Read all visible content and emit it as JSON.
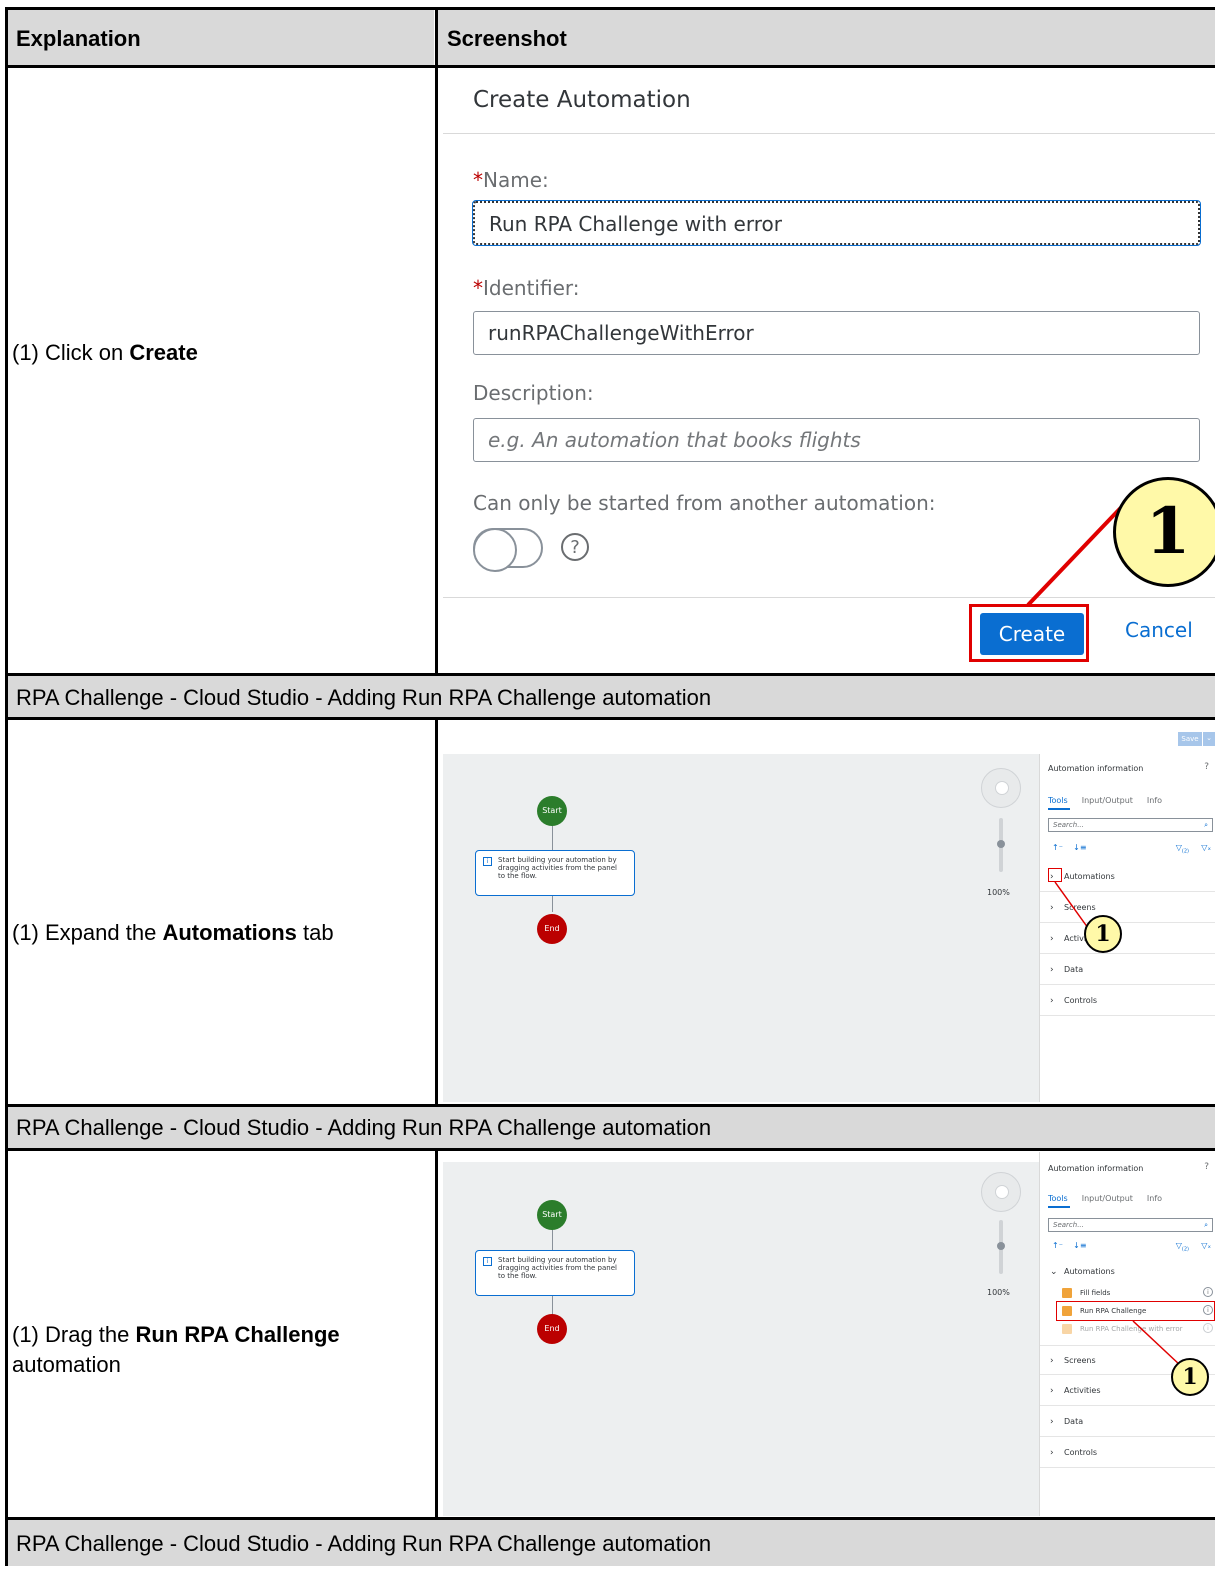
{
  "table": {
    "header_explanation": "Explanation",
    "header_screenshot": "Screenshot"
  },
  "rows": [
    {
      "step_prefix": "(1) Click on ",
      "step_bold": "Create",
      "step_suffix": ""
    },
    {
      "step_prefix": "(1) Expand the ",
      "step_bold": "Automations",
      "step_suffix": " tab"
    },
    {
      "step_prefix": "(1) Drag the ",
      "step_bold": "Run RPA Challenge",
      "step_suffix": "automation"
    }
  ],
  "band_text": "RPA Challenge - Cloud Studio - Adding Run RPA Challenge automation",
  "dialog": {
    "title": "Create Automation",
    "name_label": "Name:",
    "required_mark": "*",
    "name_value": "Run RPA Challenge with error",
    "identifier_label": "Identifier:",
    "identifier_value": "runRPAChallengeWithError",
    "description_label": "Description:",
    "description_placeholder": "e.g. An automation that books flights",
    "toggle_label": "Can only be started from another automation:",
    "toggle_on": false,
    "help_glyph": "?",
    "create_label": "Create",
    "cancel_label": "Cancel",
    "callout": "1"
  },
  "studio": {
    "save_label": "Save",
    "start_label": "Start",
    "end_label": "End",
    "info_text": "Start building your automation by dragging activities from the panel to the flow.",
    "zoom": "100%",
    "panel_title": "Automation information",
    "tabs": [
      "Tools",
      "Input/Output",
      "Info"
    ],
    "search_placeholder": "Search...",
    "filter_count": "(2)",
    "sections": [
      "Automations",
      "Screens",
      "Activities",
      "Data",
      "Controls"
    ],
    "automation_items": [
      "Fill fields",
      "Run RPA Challenge",
      "Run RPA Challenge with error"
    ],
    "callout": "1"
  },
  "colors": {
    "header_bg": "#d9d9d9",
    "accent": "#0a6ed1",
    "highlight_red": "#e00000",
    "callout_fill": "#fff9a8"
  }
}
